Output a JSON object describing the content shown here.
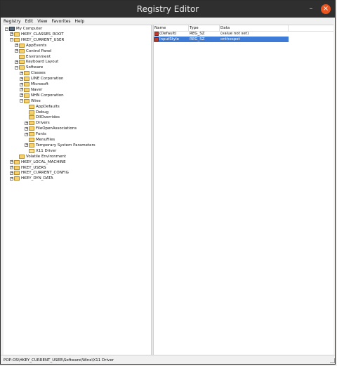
{
  "window": {
    "title": "Registry Editor",
    "close_glyph": "×",
    "minimize_glyph": "–"
  },
  "menu": [
    {
      "label": "Registry"
    },
    {
      "label": "Edit"
    },
    {
      "label": "View"
    },
    {
      "label": "Favorites"
    },
    {
      "label": "Help"
    }
  ],
  "tree": [
    {
      "label": "My Computer",
      "expander": "−",
      "icon": "computer-icon",
      "depth": 0
    },
    {
      "label": "HKEY_CLASSES_ROOT",
      "expander": "+",
      "icon": "folder-icon",
      "depth": 1
    },
    {
      "label": "HKEY_CURRENT_USER",
      "expander": "−",
      "icon": "folder-icon",
      "depth": 1
    },
    {
      "label": "AppEvents",
      "expander": "+",
      "icon": "folder-icon",
      "depth": 2
    },
    {
      "label": "Control Panel",
      "expander": "+",
      "icon": "folder-icon",
      "depth": 2
    },
    {
      "label": "Environment",
      "expander": "",
      "icon": "folder-icon",
      "depth": 2
    },
    {
      "label": "Keyboard Layout",
      "expander": "+",
      "icon": "folder-icon",
      "depth": 2
    },
    {
      "label": "Software",
      "expander": "−",
      "icon": "folder-icon",
      "depth": 2
    },
    {
      "label": "Classes",
      "expander": "+",
      "icon": "folder-icon",
      "depth": 3
    },
    {
      "label": "LINE Corporation",
      "expander": "+",
      "icon": "folder-icon",
      "depth": 3
    },
    {
      "label": "Microsoft",
      "expander": "+",
      "icon": "folder-icon",
      "depth": 3
    },
    {
      "label": "Naver",
      "expander": "+",
      "icon": "folder-icon",
      "depth": 3
    },
    {
      "label": "NHN Corporation",
      "expander": "+",
      "icon": "folder-icon",
      "depth": 3
    },
    {
      "label": "Wine",
      "expander": "−",
      "icon": "folder-icon",
      "depth": 3
    },
    {
      "label": "AppDefaults",
      "expander": "",
      "icon": "folder-icon",
      "depth": 4
    },
    {
      "label": "Debug",
      "expander": "",
      "icon": "folder-icon",
      "depth": 4
    },
    {
      "label": "DllOverrides",
      "expander": "",
      "icon": "folder-icon",
      "depth": 4
    },
    {
      "label": "Drivers",
      "expander": "+",
      "icon": "folder-icon",
      "depth": 4
    },
    {
      "label": "FileOpenAssociations",
      "expander": "+",
      "icon": "folder-icon",
      "depth": 4
    },
    {
      "label": "Fonts",
      "expander": "+",
      "icon": "folder-icon",
      "depth": 4
    },
    {
      "label": "MenuFiles",
      "expander": "",
      "icon": "folder-icon",
      "depth": 4
    },
    {
      "label": "Temporary System Parameters",
      "expander": "+",
      "icon": "folder-icon",
      "depth": 4
    },
    {
      "label": "X11 Driver",
      "expander": "",
      "icon": "folder-icon-open",
      "depth": 4
    },
    {
      "label": "Volatile Environment",
      "expander": "",
      "icon": "folder-icon",
      "depth": 2
    },
    {
      "label": "HKEY_LOCAL_MACHINE",
      "expander": "+",
      "icon": "folder-icon",
      "depth": 1
    },
    {
      "label": "HKEY_USERS",
      "expander": "+",
      "icon": "folder-icon",
      "depth": 1
    },
    {
      "label": "HKEY_CURRENT_CONFIG",
      "expander": "+",
      "icon": "folder-icon",
      "depth": 1
    },
    {
      "label": "HKEY_DYN_DATA",
      "expander": "+",
      "icon": "folder-icon",
      "depth": 1
    }
  ],
  "list": {
    "columns": [
      "Name",
      "Type",
      "Data"
    ],
    "rows": [
      {
        "name": "(Default)",
        "type": "REG_SZ",
        "data": "(value not set)",
        "selected": false
      },
      {
        "name": "InputStyle",
        "type": "REG_SZ",
        "data": "onthespot",
        "selected": true
      }
    ]
  },
  "status": {
    "path": "POP-OS\\HKEY_CURRENT_USER\\Software\\Wine\\X11 Driver"
  }
}
